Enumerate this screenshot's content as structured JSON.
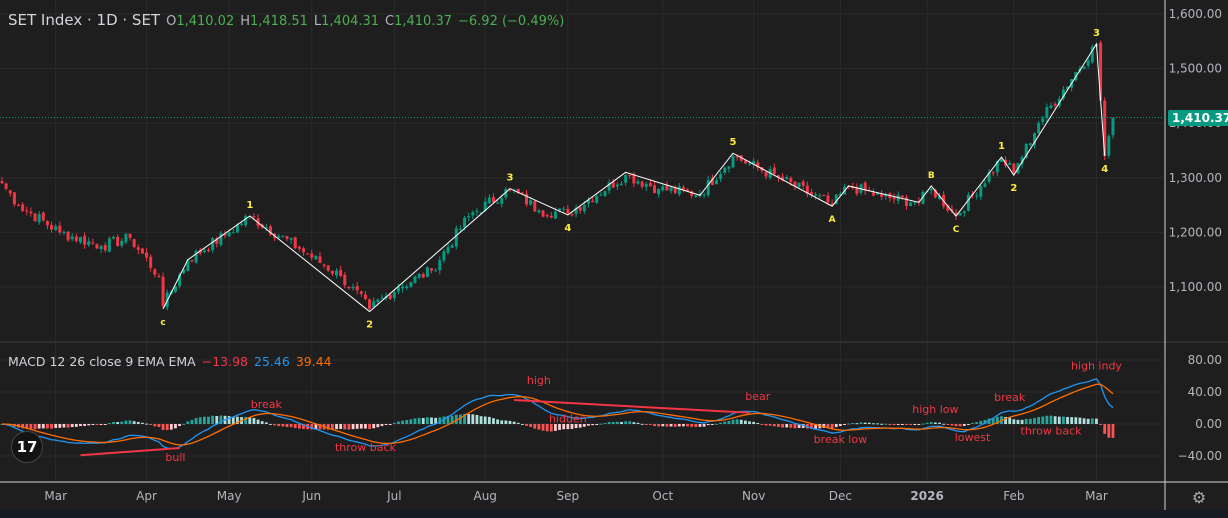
{
  "header": {
    "title": "SET Index · 1D · SET",
    "o_label": "O",
    "o": "1,410.02",
    "h_label": "H",
    "h": "1,418.51",
    "l_label": "L",
    "l": "1,404.31",
    "c_label": "C",
    "c": "1,410.37",
    "change": "−6.92 (−0.49%)"
  },
  "last_price_label": "1,410.37",
  "macd_legend": {
    "name": "MACD 12 26 close 9 EMA EMA",
    "hist": "−13.98",
    "macd": "25.46",
    "signal": "39.44"
  },
  "colors": {
    "up": "#089981",
    "down": "#f23645",
    "macd": "#2196f3",
    "signal": "#ff6d00",
    "wave": "#ffffff",
    "wave_label": "#ffeb3b",
    "annot": "#f23645"
  },
  "chart_data": [
    {
      "type": "candlestick",
      "title": "SET Index · 1D · SET",
      "ylim": [
        1000,
        1620
      ],
      "y_ticks": [
        "1,600.00",
        "1,500.00",
        "1,400.00",
        "1,300.00",
        "1,200.00",
        "1,100.00"
      ],
      "y_tick_values": [
        1600,
        1500,
        1400,
        1300,
        1200,
        1100
      ],
      "x_ticks": [
        {
          "label": "Mar",
          "bar": 13
        },
        {
          "label": "Apr",
          "bar": 35
        },
        {
          "label": "May",
          "bar": 55
        },
        {
          "label": "Jun",
          "bar": 75
        },
        {
          "label": "Jul",
          "bar": 95
        },
        {
          "label": "Aug",
          "bar": 117
        },
        {
          "label": "Sep",
          "bar": 137
        },
        {
          "label": "Oct",
          "bar": 160
        },
        {
          "label": "Nov",
          "bar": 182
        },
        {
          "label": "Dec",
          "bar": 203
        },
        {
          "label": "2026",
          "bar": 224
        },
        {
          "label": "Feb",
          "bar": 245
        },
        {
          "label": "Mar",
          "bar": 265
        }
      ],
      "close_anchors": [
        [
          0,
          1290
        ],
        [
          4,
          1250
        ],
        [
          14,
          1200
        ],
        [
          24,
          1175
        ],
        [
          31,
          1190
        ],
        [
          38,
          1120
        ],
        [
          39,
          1065
        ],
        [
          45,
          1150
        ],
        [
          55,
          1200
        ],
        [
          60,
          1230
        ],
        [
          72,
          1170
        ],
        [
          82,
          1120
        ],
        [
          89,
          1060
        ],
        [
          96,
          1100
        ],
        [
          104,
          1130
        ],
        [
          113,
          1230
        ],
        [
          123,
          1280
        ],
        [
          130,
          1240
        ],
        [
          137,
          1235
        ],
        [
          151,
          1305
        ],
        [
          159,
          1280
        ],
        [
          169,
          1270
        ],
        [
          177,
          1340
        ],
        [
          188,
          1300
        ],
        [
          201,
          1250
        ],
        [
          205,
          1285
        ],
        [
          213,
          1265
        ],
        [
          222,
          1255
        ],
        [
          225,
          1280
        ],
        [
          231,
          1230
        ],
        [
          242,
          1335
        ],
        [
          245,
          1310
        ],
        [
          251,
          1400
        ],
        [
          265,
          1545
        ],
        [
          267,
          1340
        ],
        [
          269,
          1410
        ]
      ],
      "waves": [
        [
          [
            39,
            1060,
            "c"
          ],
          [
            45,
            1150,
            ""
          ],
          [
            60,
            1230,
            "1"
          ],
          [
            89,
            1055,
            "2"
          ],
          [
            123,
            1280,
            "3"
          ],
          [
            137,
            1232,
            "4"
          ],
          [
            151,
            1310,
            ""
          ],
          [
            169,
            1268,
            ""
          ],
          [
            177,
            1345,
            "5"
          ],
          [
            201,
            1248,
            "A"
          ],
          [
            205,
            1285,
            ""
          ],
          [
            222,
            1255,
            ""
          ],
          [
            225,
            1285,
            "B"
          ],
          [
            231,
            1230,
            "C"
          ],
          [
            242,
            1338,
            "1"
          ],
          [
            245,
            1305,
            "2"
          ],
          [
            265,
            1545,
            "3"
          ],
          [
            267,
            1340,
            "4"
          ]
        ]
      ]
    },
    {
      "type": "macd",
      "title": "MACD 12 26 close 9 EMA EMA",
      "ylim": [
        -60,
        100
      ],
      "y_ticks": [
        "80.00",
        "40.00",
        "0.00",
        "−40.00"
      ],
      "y_tick_values": [
        80,
        40,
        0,
        -40
      ],
      "trend_lines": [
        [
          [
            19,
            -39
          ],
          [
            43,
            -30
          ]
        ],
        [
          [
            124,
            30
          ],
          [
            181,
            14
          ]
        ]
      ],
      "annotations": [
        {
          "text": "bull",
          "bar": 42,
          "value": -46
        },
        {
          "text": "break",
          "bar": 64,
          "value": 20
        },
        {
          "text": "throw back",
          "bar": 88,
          "value": -34
        },
        {
          "text": "high",
          "bar": 130,
          "value": 50
        },
        {
          "text": "hidden",
          "bar": 137,
          "value": 2
        },
        {
          "text": "bear",
          "bar": 183,
          "value": 30
        },
        {
          "text": "break low",
          "bar": 203,
          "value": -24
        },
        {
          "text": "high low",
          "bar": 226,
          "value": 14
        },
        {
          "text": "lowest",
          "bar": 235,
          "value": -21
        },
        {
          "text": "break",
          "bar": 244,
          "value": 29
        },
        {
          "text": "throw back",
          "bar": 254,
          "value": -13
        },
        {
          "text": "high indy",
          "bar": 265,
          "value": 68
        }
      ]
    }
  ]
}
